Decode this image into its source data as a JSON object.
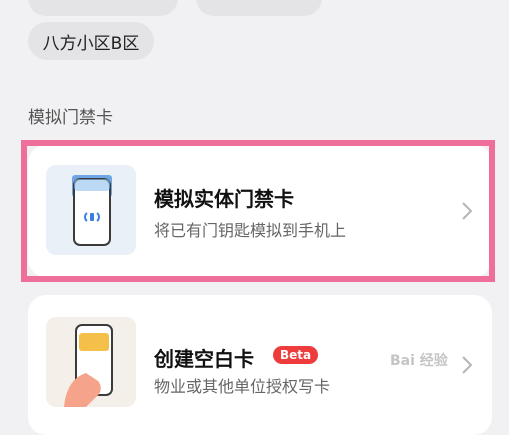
{
  "filters": {
    "chip_main_label": "八方小区B区"
  },
  "section": {
    "title": "模拟门禁卡"
  },
  "cards": [
    {
      "title": "模拟实体门禁卡",
      "subtitle": "将已有门钥匙模拟到手机上",
      "icon": "phone-nfc-icon"
    },
    {
      "title": "创建空白卡",
      "badge": "Beta",
      "subtitle": "物业或其他单位授权写卡",
      "icon": "hand-phone-icon"
    }
  ],
  "colors": {
    "highlight": "#ef6f9b",
    "badge": "#ee3c3c",
    "background": "#f1f1f3"
  },
  "watermark": {
    "text": "Bai 经验"
  }
}
